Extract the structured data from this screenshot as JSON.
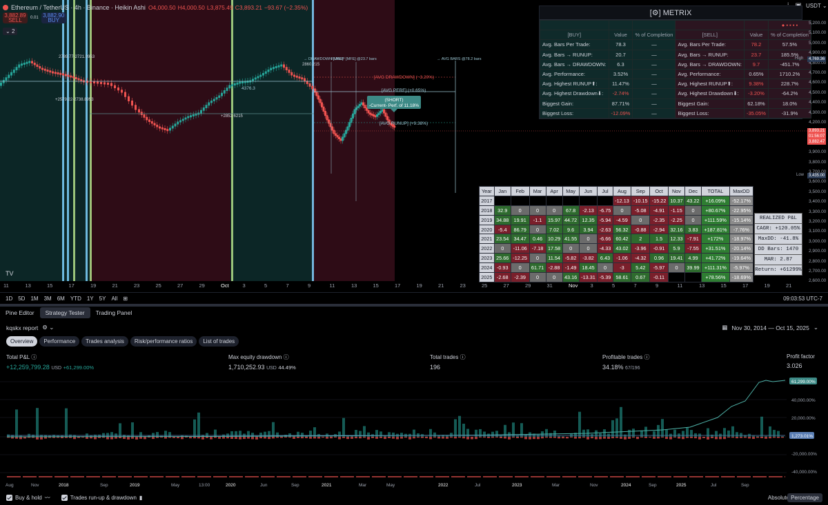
{
  "chart": {
    "symbol": "Ethereum / TetherUS · 4h · Binance · Heikin Ashi",
    "ohlc": {
      "o": "O4,000.50",
      "h": "H4,000.50",
      "l": "L3,875.49",
      "c": "C3,893.21",
      "chg": "−93.67 (−2.35%)"
    },
    "sell_price": "3,882.89",
    "sell_label": "SELL",
    "spread": "0.01",
    "buy_price": "3,882.90",
    "buy_label": "BUY",
    "indicator_count": "2",
    "currency": "USDT",
    "time_ticks": [
      "11",
      "13",
      "15",
      "17",
      "19",
      "21",
      "23",
      "25",
      "27",
      "29",
      "Oct",
      "3",
      "5",
      "7",
      "9",
      "11",
      "13",
      "15",
      "17",
      "19",
      "21",
      "23",
      "25",
      "27",
      "29",
      "31",
      "Nov",
      "3",
      "5",
      "7",
      "9",
      "11",
      "13",
      "15",
      "17",
      "19",
      "21"
    ],
    "price_ticks": [
      "5,200.00",
      "5,100.00",
      "5,000.00",
      "4,900.00",
      "4,800.00",
      "4,700.00",
      "4,600.00",
      "4,500.00",
      "4,400.00",
      "4,300.00",
      "4,200.00",
      "4,100.00",
      "4,000.00",
      "3,900.00",
      "3,800.00",
      "3,700.00",
      "3,600.00",
      "3,500.00",
      "3,400.00",
      "3,300.00",
      "3,200.00",
      "3,100.00",
      "3,000.00",
      "2,900.00",
      "2,800.00",
      "2,700.00",
      "2,600.00"
    ],
    "high_label": "High",
    "high_value": "4,769.36",
    "low_label": "Low",
    "low_value": "3,435.00",
    "cur_price": "3,893.21",
    "cur_time": "01:56:07",
    "cur_price2": "3,882.47",
    "annotations": {
      "avg_drawdown": "[AVG DRAWDOWN] (−3.20%)",
      "avg_perf": "[AVG PERF] (+0.65%)",
      "avg_runup": "[AVG RUNUP] (+9.38%)",
      "short_title": "(SHORT)",
      "short_perf": "-Current- Perf. of 11.18%",
      "avg_bars": "→ AVG BARS @78.2 bars",
      "runup_bars": "RUNUP [MFE] @23.7 bars",
      "drawdown_mae": "→ DRAWDOWN [MAE]",
      "level1": "4376.3",
      "left1": "2789.77-2721.0953",
      "left2": "+2579.22-2738.8953",
      "mid1": "2860.215",
      "mid2": "+2852.6215"
    }
  },
  "metrix": {
    "title": "[⚙] METRIX",
    "header": [
      "[BUY]",
      "Value",
      "% of Completion",
      "[SELL]",
      "Value",
      "% of Completion"
    ],
    "rows": [
      [
        "Avg. Bars Per Trade:",
        "78.3",
        "—",
        "Avg. Bars Per Trade:",
        "78.2",
        "57.5%"
      ],
      [
        "Avg. Bars → RUNUP:",
        "20.7",
        "—",
        "Avg. Bars → RUNUP:",
        "23.7",
        "185.5%"
      ],
      [
        "Avg. Bars → DRAWDOWN:",
        "6.3",
        "—",
        "Avg. Bars → DRAWDOWN:",
        "9.7",
        "-451.7%"
      ],
      [
        "Avg. Performance:",
        "3.52%",
        "—",
        "Avg. Performance:",
        "0.65%",
        "1710.2%"
      ],
      [
        "Avg. Highest RUNUP⬆:",
        "11.47%",
        "—",
        "Avg. Highest RUNUP⬆:",
        "9.38%",
        "228.7%"
      ],
      [
        "Avg. Highest Drawdown⬇:",
        "-2.74%",
        "—",
        "Avg. Highest Drawdown⬇:",
        "-3.20%",
        "-64.2%"
      ],
      [
        "Biggest Gain:",
        "87.71%",
        "—",
        "Biggest Gain:",
        "62.18%",
        "18.0%"
      ],
      [
        "Biggest Loss:",
        "-12.09%",
        "—",
        "Biggest Loss:",
        "-35.05%",
        "-31.9%"
      ]
    ]
  },
  "pnl": {
    "header": [
      "Year",
      "Jan",
      "Feb",
      "Mar",
      "Apr",
      "May",
      "Jun",
      "Jul",
      "Aug",
      "Sep",
      "Oct",
      "Nov",
      "Dec",
      "TOTAL",
      "MaxDD"
    ],
    "rows": [
      [
        "2017",
        "",
        "",
        "",
        "",
        "",
        "",
        "",
        "-12.13",
        "-10.15",
        "-15.22",
        "10.37",
        "43.22",
        "+16.09%",
        "-52.17%"
      ],
      [
        "2018",
        "32.9",
        "0",
        "0",
        "0",
        "67.8",
        "-2.13",
        "-6.75",
        "0",
        "-5.08",
        "-4.91",
        "-1.15",
        "0",
        "+80.67%",
        "-22.95%"
      ],
      [
        "2019",
        "34.88",
        "19.91",
        "-1.1",
        "15.97",
        "44.72",
        "12.35",
        "-5.94",
        "-4.59",
        "0",
        "-2.35",
        "-2.25",
        "0",
        "+111.59%",
        "-15.14%"
      ],
      [
        "2020",
        "-5.4",
        "86.79",
        "0",
        "7.02",
        "9.6",
        "3.94",
        "-2.63",
        "56.32",
        "-0.88",
        "-2.94",
        "32.16",
        "3.83",
        "+187.81%",
        "-7.76%"
      ],
      [
        "2021",
        "23.54",
        "34.47",
        "0.46",
        "10.29",
        "41.55",
        "0",
        "-6.66",
        "60.42",
        "2",
        "1.5",
        "12.33",
        "-7.91",
        "+172%",
        "-18.97%"
      ],
      [
        "2022",
        "0",
        "-11.06",
        "-7.18",
        "17.58",
        "0",
        "0",
        "-4.33",
        "43.02",
        "-3.96",
        "-0.91",
        "5.9",
        "-7.55",
        "+31.51%",
        "-20.14%"
      ],
      [
        "2023",
        "25.66",
        "-12.25",
        "0",
        "11.54",
        "-5.82",
        "-3.82",
        "6.43",
        "-1.06",
        "-4.32",
        "0.96",
        "19.41",
        "4.99",
        "+41.72%",
        "-19.64%"
      ],
      [
        "2024",
        "-0.93",
        "0",
        "61.71",
        "-2.88",
        "-1.49",
        "18.45",
        "0",
        "-3",
        "5.42",
        "-5.97",
        "0",
        "39.99",
        "+111.31%",
        "-5.97%"
      ],
      [
        "2025",
        "-2.68",
        "-2.39",
        "0",
        "0",
        "43.16",
        "-13.31",
        "-5.39",
        "58.61",
        "0.67",
        "-0.11",
        "",
        "",
        "+78.56%",
        "-18.69%"
      ]
    ]
  },
  "realized": [
    "REALIZED P&L",
    "CAGR: +120.05%",
    "MaxDD: -41.8%",
    "DD Bars: 1470",
    "MAR: 2.87",
    "Return: +61299%"
  ],
  "timeframes": [
    "1D",
    "5D",
    "1M",
    "3M",
    "6M",
    "YTD",
    "1Y",
    "5Y",
    "All"
  ],
  "clock": "09:03:53 UTC-7",
  "panel_tabs": [
    "Pine Editor",
    "Strategy Tester",
    "Trading Panel"
  ],
  "report_name": "kqskx report",
  "date_range": "Nov 30, 2014 — Oct 15, 2025",
  "st_tabs": [
    "Overview",
    "Performance",
    "Trades analysis",
    "Risk/performance ratios",
    "List of trades"
  ],
  "kpis": {
    "pnl": {
      "label": "Total P&L",
      "value": "+12,259,799.28",
      "unit": "USD",
      "pct": "+61,299.00%"
    },
    "dd": {
      "label": "Max equity drawdown",
      "value": "1,710,252.93",
      "unit": "USD",
      "pct": "44.49%"
    },
    "trades": {
      "label": "Total trades",
      "value": "196"
    },
    "profitable": {
      "label": "Profitable trades",
      "value": "34.18%",
      "sub": "67/196"
    },
    "pf": {
      "label": "Profit factor",
      "value": "3.026"
    }
  },
  "equity": {
    "y_ticks": [
      "60,000.00%",
      "40,000.00%",
      "20,000.00%",
      "0.00%",
      "-20,000.00%",
      "-40,000.00%"
    ],
    "end_label": "61,299.00%",
    "bh_label": "1,273.01%",
    "x_ticks": [
      "Aug",
      "Nov",
      "2018",
      "Sep",
      "2019",
      "May",
      "13:00",
      "2020",
      "Jun",
      "Sep",
      "2021",
      "Mar",
      "May",
      "2022",
      "Jul",
      "2023",
      "Mar",
      "Nov",
      "2024",
      "Sep",
      "2025",
      "Jul",
      "Sep"
    ]
  },
  "bottom": {
    "buyhold": "Buy & hold",
    "runup": "Trades run-up & drawdown",
    "absolute": "Absolute",
    "percentage": "Percentage"
  },
  "colors": {
    "up": "#26a69a",
    "down": "#ef5350",
    "bg": "#000000",
    "panel": "#131722",
    "accent": "#2962ff"
  }
}
